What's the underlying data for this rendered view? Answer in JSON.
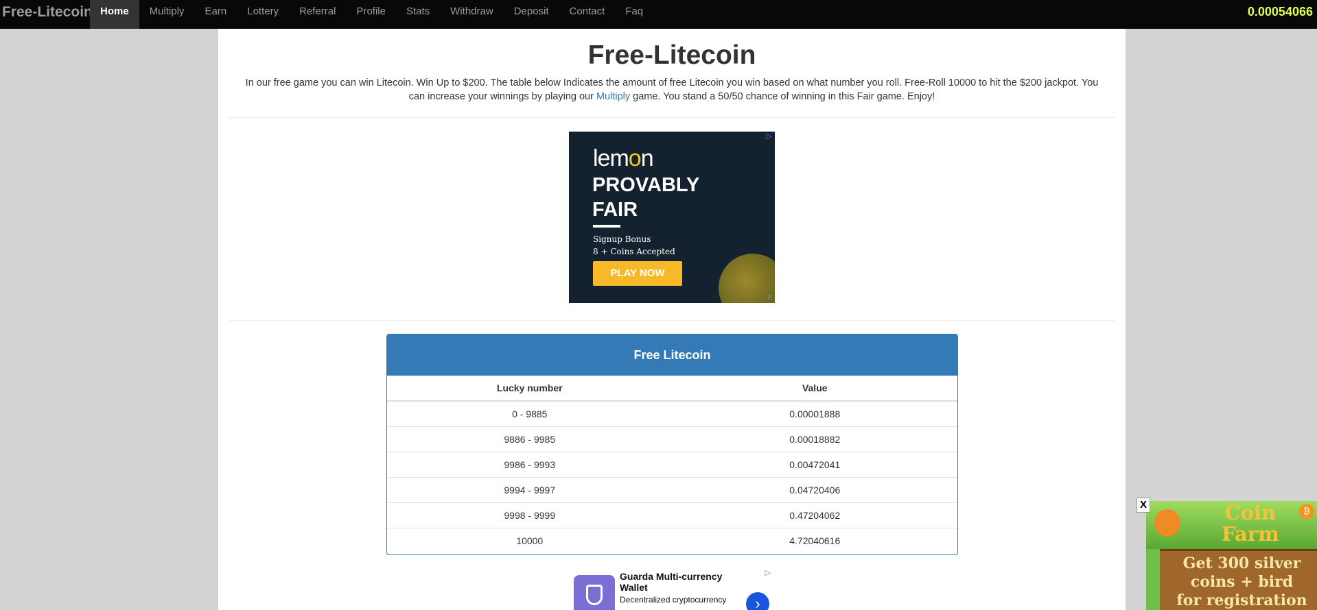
{
  "navbar": {
    "brand": "Free-Litecoin",
    "items": [
      {
        "label": "Home",
        "active": true
      },
      {
        "label": "Multiply"
      },
      {
        "label": "Earn"
      },
      {
        "label": "Lottery"
      },
      {
        "label": "Referral"
      },
      {
        "label": "Profile"
      },
      {
        "label": "Stats"
      },
      {
        "label": "Withdraw"
      },
      {
        "label": "Deposit"
      },
      {
        "label": "Contact"
      },
      {
        "label": "Faq"
      }
    ],
    "balance": "0.00054066"
  },
  "main": {
    "title": "Free-Litecoin",
    "intro_before": "In our free game you can win Litecoin. Win Up to $200. The table below Indicates the amount of free Litecoin you win based on what number you roll. Free-Roll 10000 to hit the $200 jackpot. You can increase your winnings by playing our ",
    "intro_link": "Multiply",
    "intro_after": " game. You stand a 50/50 chance of winning in this Fair game. Enjoy!"
  },
  "ad_top": {
    "logo_pre": "lem",
    "logo_o": "o",
    "logo_post": "n",
    "headline_1": "PROVABLY",
    "headline_2": "FAIR",
    "sub_1": "Signup Bonus",
    "sub_2": "8 + Coins Accepted",
    "cta": "PLAY NOW",
    "adchoice": "▷",
    "adchoice_b": "B"
  },
  "table": {
    "title": "Free Litecoin",
    "headers": [
      "Lucky number",
      "Value"
    ],
    "rows": [
      [
        "0 - 9885",
        "0.00001888"
      ],
      [
        "9886 - 9985",
        "0.00018882"
      ],
      [
        "9986 - 9993",
        "0.00472041"
      ],
      [
        "9994 - 9997",
        "0.04720406"
      ],
      [
        "9998 - 9999",
        "0.47204062"
      ],
      [
        "10000",
        "4.72040616"
      ]
    ]
  },
  "ad_bottom": {
    "title": "Guarda Multi-currency Wallet",
    "desc": "Decentralized cryptocurrency",
    "adchoice": "▷",
    "arrow": "›"
  },
  "float_ad": {
    "close": "X",
    "title_1": "Coin",
    "title_2": "Farm",
    "text_1": "Get 300 silver",
    "text_2": "coins + bird",
    "text_3": "for registration",
    "btc": "₿"
  }
}
